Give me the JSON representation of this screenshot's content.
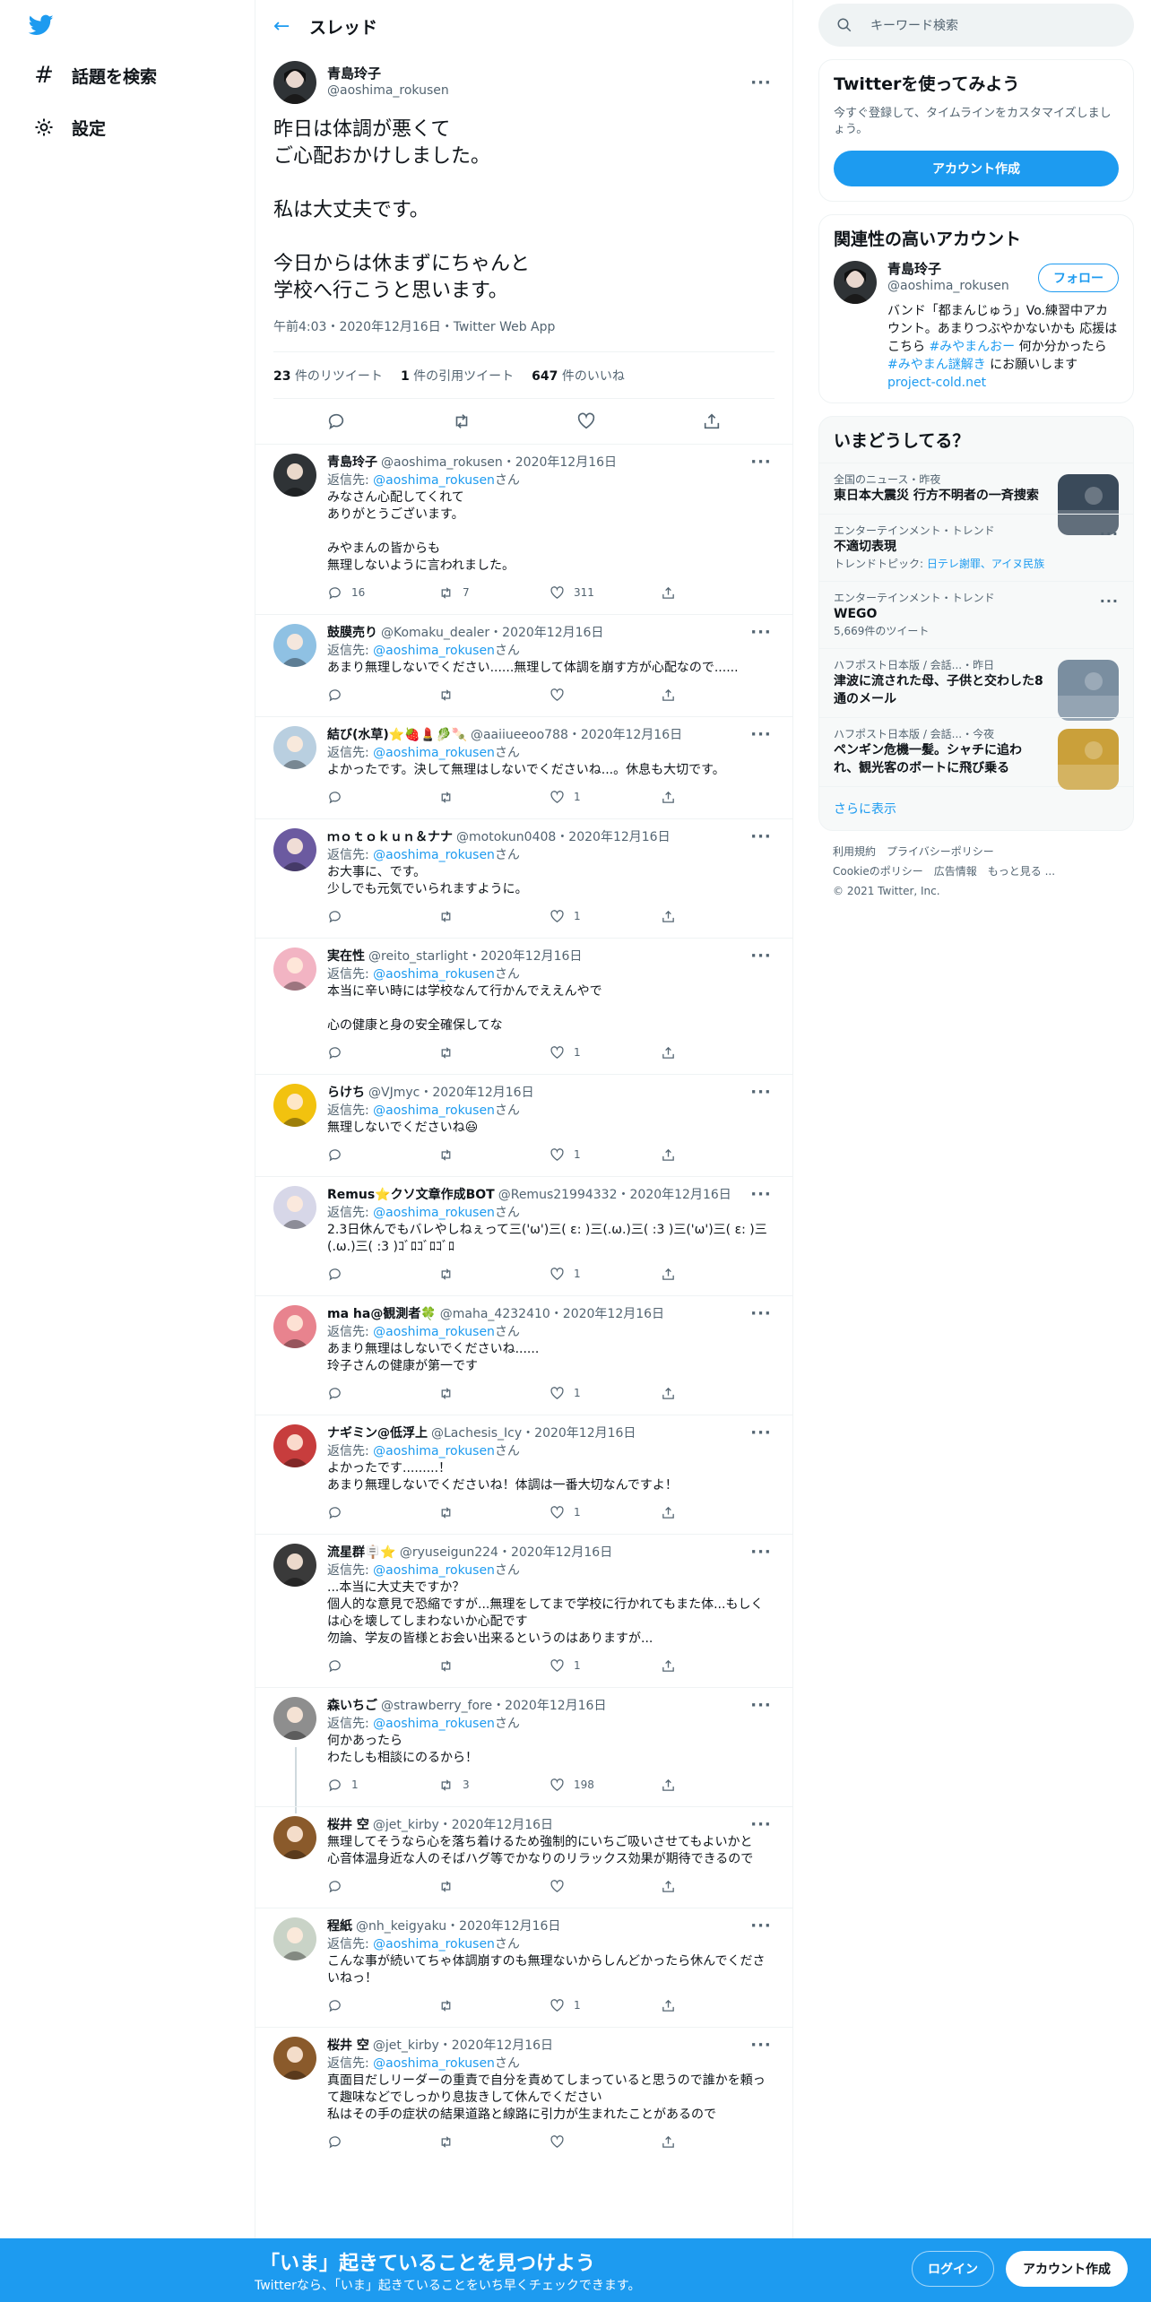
{
  "nav": {
    "explore_label": "話題を検索",
    "settings_label": "設定"
  },
  "header": {
    "title": "スレッド"
  },
  "main_tweet": {
    "name": "青島玲子",
    "handle": "@aoshima_rokusen",
    "text": "昨日は体調が悪くて\nご心配おかけしました。\n\n私は大丈夫です。\n\n今日からは休まずにちゃんと\n学校へ行こうと思います。",
    "meta": "午前4:03・2020年12月16日・Twitter Web App",
    "retweets_count": "23",
    "retweets_label": "件のリツイート",
    "quotes_count": "1",
    "quotes_label": "件の引用ツイート",
    "likes_count": "647",
    "likes_label": "件のいいね"
  },
  "reply_to_prefix": "返信先: ",
  "reply_to_handle": "@aoshima_rokusen",
  "reply_to_suffix": "さん",
  "replies": [
    {
      "name": "青島玲子",
      "handle": "@aoshima_rokusen",
      "date": "・2020年12月16日",
      "text": "みなさん心配してくれて\nありがとうございます。\n\nみやまんの皆からも\n無理しないように言われました。",
      "reply": "16",
      "rt": "7",
      "like": "311",
      "color": "#2f3336"
    },
    {
      "name": "鼓膜売り",
      "handle": "@Komaku_dealer",
      "date": "・2020年12月16日",
      "text": "あまり無理しないでください......無理して体調を崩す方が心配なので......",
      "reply": "",
      "rt": "",
      "like": "",
      "color": "#8fc1e3"
    },
    {
      "name": "結び(水草)⭐🍓💄🥬🍡",
      "handle": "@aaiiueeoo788",
      "date": "・2020年12月16日",
      "text": "よかったです。決して無理はしないでくださいね...。休息も大切です。",
      "reply": "",
      "rt": "",
      "like": "1",
      "color": "#b9cfe0"
    },
    {
      "name": "ｍｏｔｏｋｕｎ＆ナナ",
      "handle": "@motokun0408",
      "date": "・2020年12月16日",
      "text": "お大事に、です。\n少しでも元気でいられますように。",
      "reply": "",
      "rt": "",
      "like": "1",
      "color": "#6b5aa0"
    },
    {
      "name": "実在性",
      "handle": "@reito_starlight",
      "date": "・2020年12月16日",
      "text": "本当に辛い時には学校なんて行かんでええんやで\n\n心の健康と身の安全確保してな",
      "reply": "",
      "rt": "",
      "like": "1",
      "color": "#f2b4c3"
    },
    {
      "name": "らけち",
      "handle": "@VJmyc",
      "date": "・2020年12月16日",
      "text": "無理しないでくださいね😃",
      "reply": "",
      "rt": "",
      "like": "1",
      "color": "#f2c20f"
    },
    {
      "name": "Remus⭐クソ文章作成BOT",
      "handle": "@Remus21994332",
      "date": "・2020年12月16日",
      "text": "2.3日休んでもバレやしねぇって三('ω')三( ε: )三(.ω.)三( :3 )三('ω')三( ε: )三(.ω.)三( :3 )ｺﾞﾛｺﾞﾛｺﾞﾛ",
      "reply": "",
      "rt": "",
      "like": "1",
      "color": "#d7d7e8"
    },
    {
      "name": "ma ha@観測者🍀",
      "handle": "@maha_4232410",
      "date": "・2020年12月16日",
      "text": "あまり無理はしないでくださいね......\n玲子さんの健康が第一です",
      "reply": "",
      "rt": "",
      "like": "1",
      "color": "#e8838e"
    },
    {
      "name": "ナギミン@低浮上",
      "handle": "@Lachesis_Icy",
      "date": "・2020年12月16日",
      "text": "よかったです.........！\nあまり無理しないでくださいね！体調は一番大切なんですよ！",
      "reply": "",
      "rt": "",
      "like": "1",
      "color": "#c73d3d"
    },
    {
      "name": "流星群🪧⭐",
      "handle": "@ryuseigun224",
      "date": "・2020年12月16日",
      "text": "...本当に大丈夫ですか？\n個人的な意見で恐縮ですが...無理をしてまで学校に行かれてもまた体...もしくは心を壊してしまわないか心配です\n勿論、学友の皆様とお会い出来るというのはありますが...",
      "reply": "",
      "rt": "",
      "like": "1",
      "color": "#3a3a3a"
    },
    {
      "name": "森いちご",
      "handle": "@strawberry_fore",
      "date": "・2020年12月16日",
      "text": "何かあったら\nわたしも相談にのるから！",
      "reply": "1",
      "rt": "3",
      "like": "198",
      "color": "#8e8e8e"
    },
    {
      "name": "桜井 空",
      "handle": "@jet_kirby",
      "date": "・2020年12月16日",
      "text": "無理してそうなら心を落ち着けるため強制的にいちご吸いさせてもよいかと\n心音体温身近な人のそばハグ等でかなりのリラックス効果が期待できるので",
      "reply": "",
      "rt": "",
      "like": "",
      "color": "#8a5a2b",
      "noto": true
    },
    {
      "name": "程紙",
      "handle": "@nh_keigyaku",
      "date": "・2020年12月16日",
      "text": "こんな事が続いてちゃ体調崩すのも無理ないからしんどかったら休んでくださいねっ！",
      "reply": "",
      "rt": "",
      "like": "1",
      "color": "#c9d3c7"
    },
    {
      "name": "桜井 空",
      "handle": "@jet_kirby",
      "date": "・2020年12月16日",
      "text": "真面目だしリーダーの重責で自分を責めてしまっていると思うので誰かを頼って趣味などでしっかり息抜きして休んでください\n私はその手の症状の結果道路と線路に引力が生まれたことがあるので",
      "reply": "",
      "rt": "",
      "like": "",
      "color": "#8a5a2b"
    }
  ],
  "sidebar": {
    "search_placeholder": "キーワード検索",
    "signup_title": "Twitterを使ってみよう",
    "signup_desc": "今すぐ登録して、タイムラインをカスタマイズしましょう。",
    "signup_button": "アカウント作成",
    "related_title": "関連性の高いアカウント",
    "related_name": "青島玲子",
    "related_handle": "@aoshima_rokusen",
    "follow_label": "フォロー",
    "related_bio_1": "バンド「都まんじゅう」Vo.練習中アカウント。あまりつぶやかないかも 応援はこちら ",
    "related_bio_tag1": "#みやまんおー",
    "related_bio_2": " 何か分かったら ",
    "related_bio_tag2": "#みやまん謎解き",
    "related_bio_3": " にお願いします ",
    "related_bio_link": "project-cold.net",
    "trends_title": "いまどうしてる？",
    "trends": [
      {
        "meta": "全国のニュース・昨夜",
        "title": "東日本大震災 行方不明者の一斉捜索",
        "sub": "",
        "thumb": "#3a4a5a"
      },
      {
        "meta": "エンターテインメント・トレンド",
        "title": "不適切表現",
        "sub": "トレンドトピック: ",
        "links": "日テレ謝罪、アイヌ民族"
      },
      {
        "meta": "エンターテインメント・トレンド",
        "title": "WEGO",
        "sub": "5,669件のツイート",
        "links": ""
      },
      {
        "meta": "ハフポスト日本版 / 会話...・昨日",
        "title": "津波に流された母、子供と交わした8通のメール",
        "sub": "",
        "thumb": "#7a8ea0"
      },
      {
        "meta": "ハフポスト日本版 / 会話...・今夜",
        "title": "ペンギン危機一髪。シャチに追われ、観光客のボートに飛び乗る",
        "sub": "",
        "thumb": "#caa03a"
      }
    ],
    "show_more": "さらに表示",
    "footer_1": "利用規約",
    "footer_2": "プライバシーポリシー",
    "footer_3": "Cookieのポリシー",
    "footer_4": "広告情報",
    "footer_5": "もっと見る ...",
    "footer_6": "© 2021 Twitter, Inc."
  },
  "bottom_bar": {
    "title": "「いま」起きていることを見つけよう",
    "subtitle": "Twitterなら、「いま」起きていることをいち早くチェックできます。",
    "login": "ログイン",
    "signup": "アカウント作成"
  },
  "colors": {
    "accent": "#1d9bf0",
    "text": "#0f1419",
    "secondary": "#536471"
  }
}
